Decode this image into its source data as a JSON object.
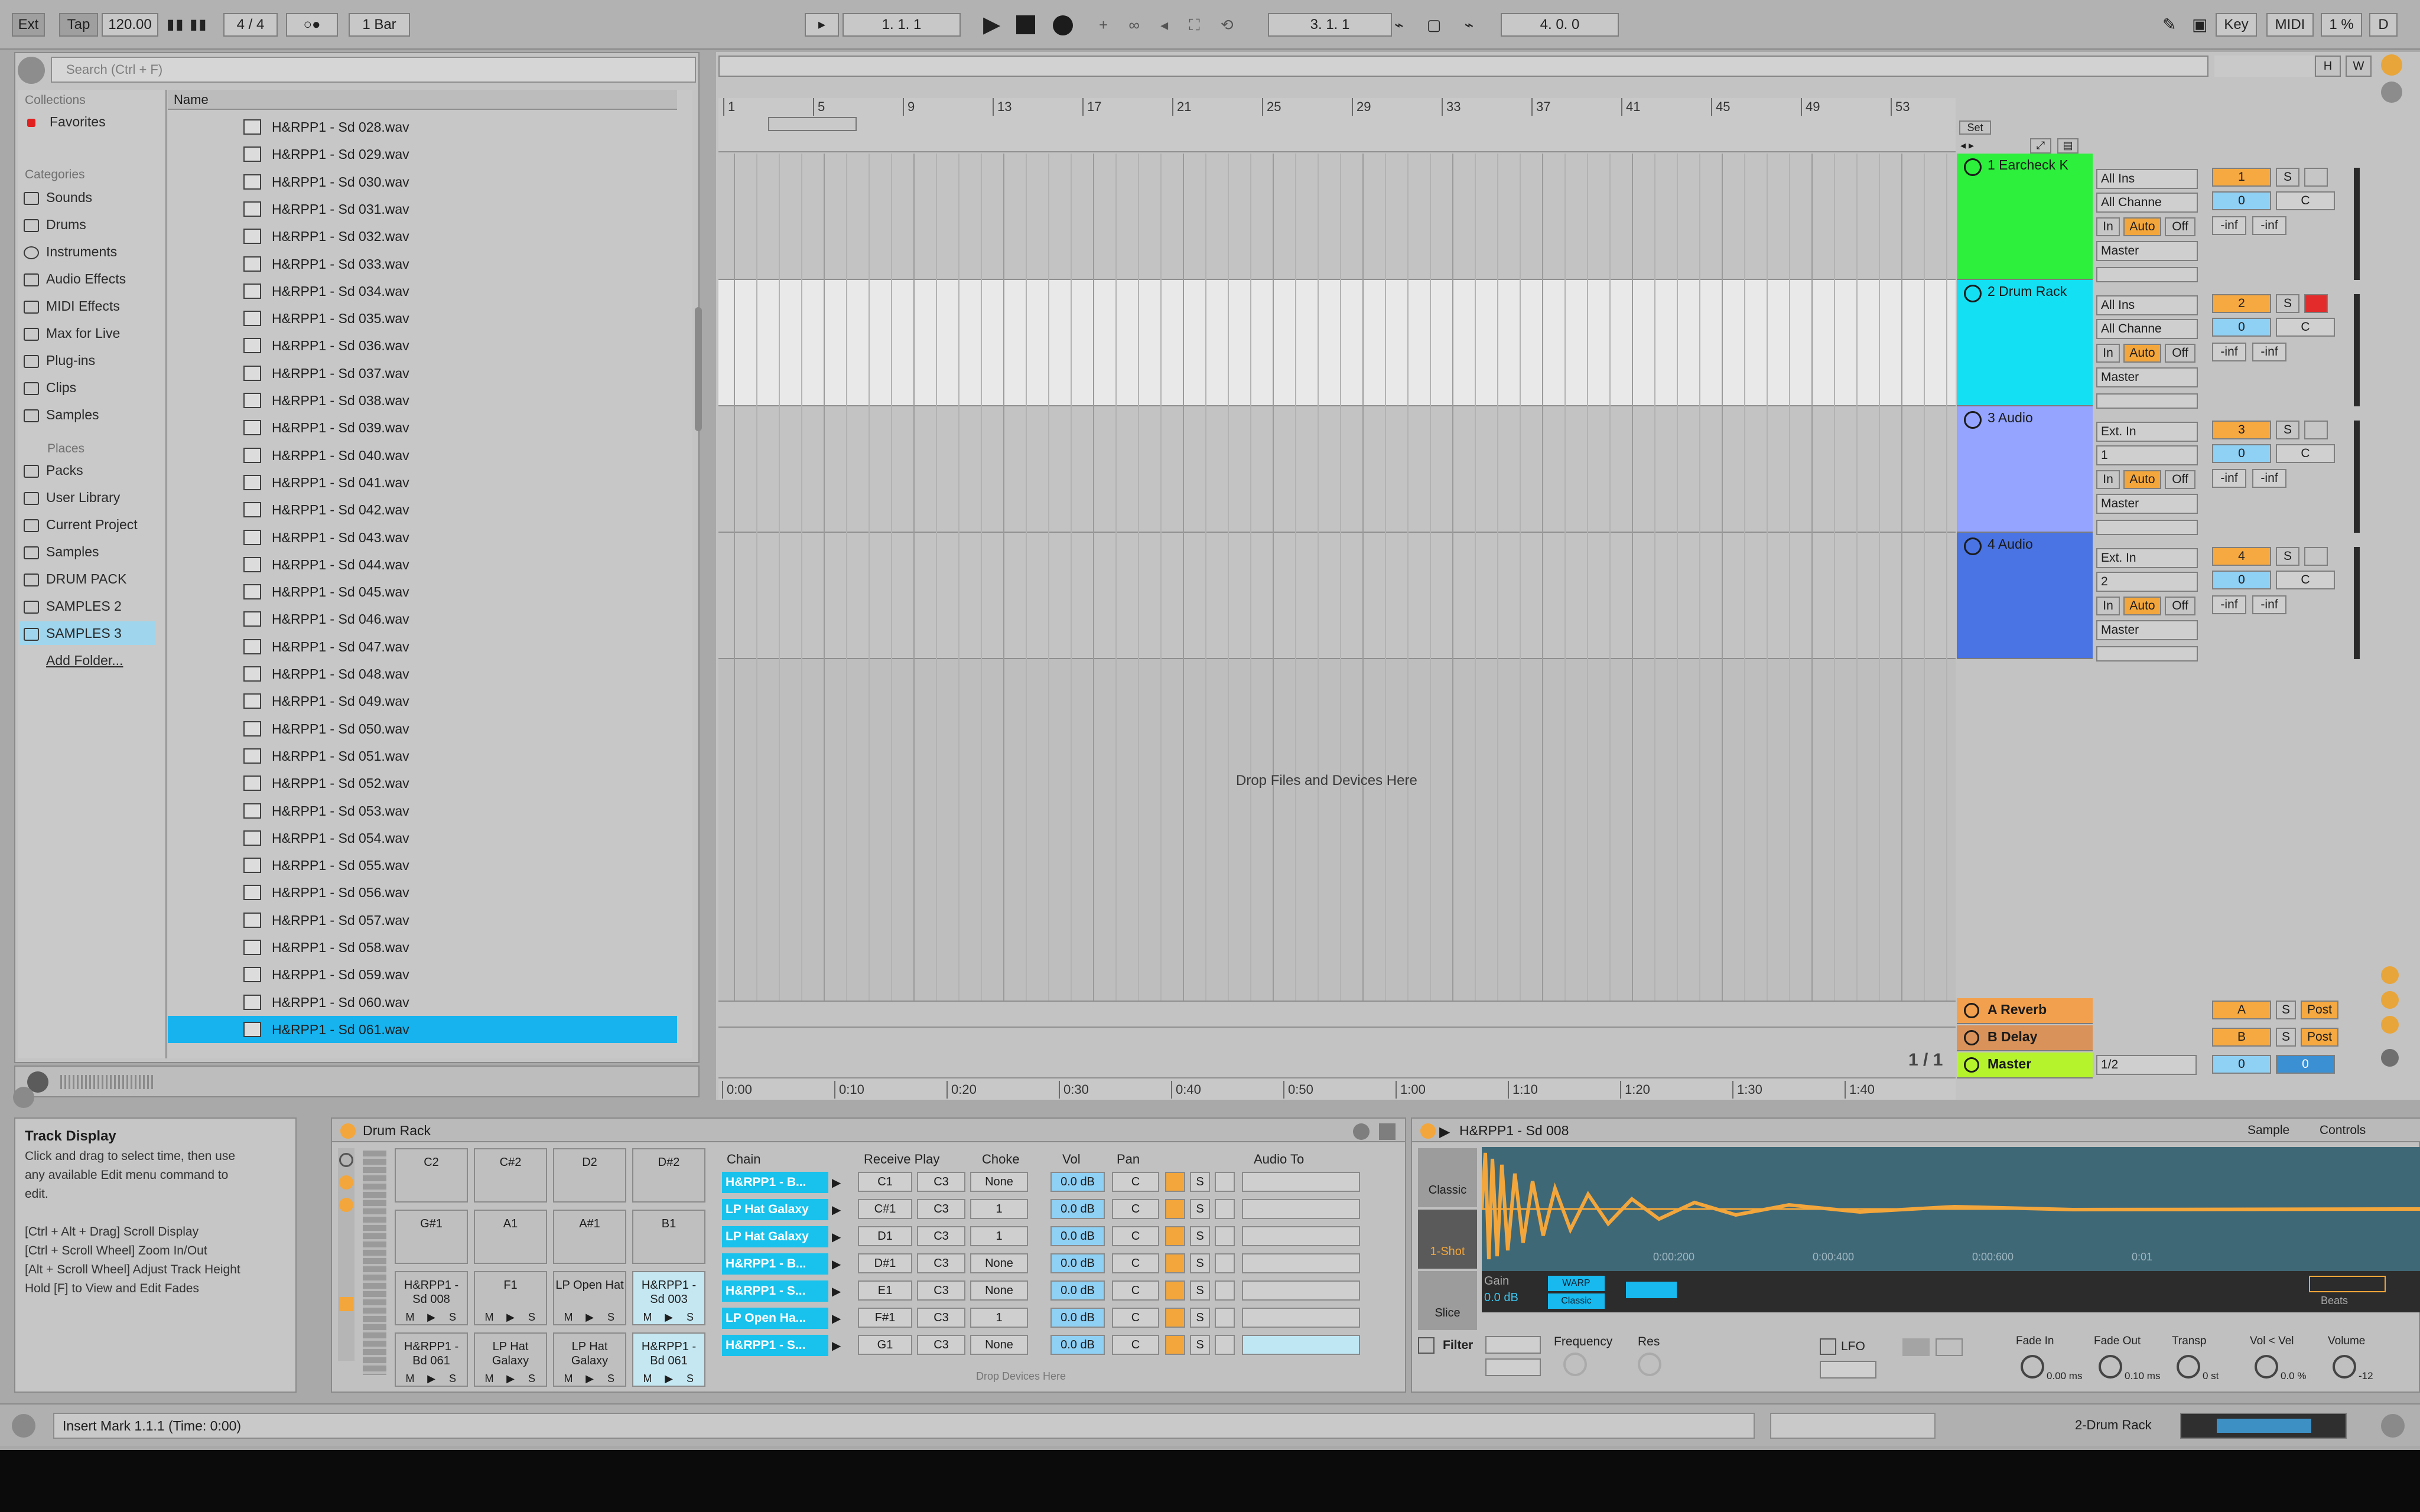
{
  "topbar": {
    "ext": "Ext",
    "tap": "Tap",
    "tempo": "120.00",
    "sig": "4 / 4",
    "metro": "○●",
    "quant": "1 Bar",
    "pos1": "1.  1.  1",
    "pos2": "3.  1.  1",
    "len": "4.  0.  0",
    "key": "Key",
    "midi": "MIDI",
    "cpu": "1 %",
    "d": "D"
  },
  "browser": {
    "search_placeholder": "Search (Ctrl + F)",
    "collections_head": "Collections",
    "favorites": "Favorites",
    "categories_head": "Categories",
    "categories": [
      "Sounds",
      "Drums",
      "Instruments",
      "Audio Effects",
      "MIDI Effects",
      "Max for Live",
      "Plug-ins",
      "Clips",
      "Samples"
    ],
    "places_head": "Places",
    "places": [
      "Packs",
      "User Library",
      "Current Project",
      "Samples",
      "DRUM PACK",
      "SAMPLES 2",
      "SAMPLES 3",
      "Add Folder..."
    ],
    "name_col": "Name",
    "files": [
      "H&RPP1 - Sd 028.wav",
      "H&RPP1 - Sd 029.wav",
      "H&RPP1 - Sd 030.wav",
      "H&RPP1 - Sd 031.wav",
      "H&RPP1 - Sd 032.wav",
      "H&RPP1 - Sd 033.wav",
      "H&RPP1 - Sd 034.wav",
      "H&RPP1 - Sd 035.wav",
      "H&RPP1 - Sd 036.wav",
      "H&RPP1 - Sd 037.wav",
      "H&RPP1 - Sd 038.wav",
      "H&RPP1 - Sd 039.wav",
      "H&RPP1 - Sd 040.wav",
      "H&RPP1 - Sd 041.wav",
      "H&RPP1 - Sd 042.wav",
      "H&RPP1 - Sd 043.wav",
      "H&RPP1 - Sd 044.wav",
      "H&RPP1 - Sd 045.wav",
      "H&RPP1 - Sd 046.wav",
      "H&RPP1 - Sd 047.wav",
      "H&RPP1 - Sd 048.wav",
      "H&RPP1 - Sd 049.wav",
      "H&RPP1 - Sd 050.wav",
      "H&RPP1 - Sd 051.wav",
      "H&RPP1 - Sd 052.wav",
      "H&RPP1 - Sd 053.wav",
      "H&RPP1 - Sd 054.wav",
      "H&RPP1 - Sd 055.wav",
      "H&RPP1 - Sd 056.wav",
      "H&RPP1 - Sd 057.wav",
      "H&RPP1 - Sd 058.wav",
      "H&RPP1 - Sd 059.wav",
      "H&RPP1 - Sd 060.wav",
      "H&RPP1 - Sd 061.wav"
    ],
    "selected_index": 33
  },
  "arrangement": {
    "bars": [
      "1",
      "5",
      "9",
      "13",
      "17",
      "21",
      "25",
      "29",
      "33",
      "37",
      "41",
      "45",
      "49",
      "53"
    ],
    "times": [
      "0:00",
      "0:10",
      "0:20",
      "0:30",
      "0:40",
      "0:50",
      "1:00",
      "1:10",
      "1:20",
      "1:30",
      "1:40"
    ],
    "drop_msg": "Drop Files and Devices Here",
    "page": "1 / 1",
    "set": "Set"
  },
  "tracks": [
    {
      "name": "1 Earcheck K",
      "color": "#2cf03c",
      "input": "All Ins",
      "channel": "All Channe",
      "out": "Master",
      "num": "1",
      "vol": "0",
      "pan": "C",
      "armed": false
    },
    {
      "name": "2 Drum Rack",
      "color": "#14e0f4",
      "input": "All Ins",
      "channel": "All Channe",
      "out": "Master",
      "num": "2",
      "vol": "0",
      "pan": "C",
      "armed": true
    },
    {
      "name": "3 Audio",
      "color": "#94a4ff",
      "input": "Ext. In",
      "channel": "1",
      "out": "Master",
      "num": "3",
      "vol": "0",
      "pan": "C",
      "armed": false
    },
    {
      "name": "4 Audio",
      "color": "#4a74e4",
      "input": "Ext. In",
      "channel": "2",
      "out": "Master",
      "num": "4",
      "vol": "0",
      "pan": "C",
      "armed": false
    }
  ],
  "monitor": {
    "in": "In",
    "auto": "Auto",
    "off": "Off"
  },
  "inf": "-inf",
  "returns": [
    {
      "name": "A Reverb",
      "color": "#f2a04e",
      "num": "A",
      "post": "Post"
    },
    {
      "name": "B Delay",
      "color": "#d9935a",
      "num": "B",
      "post": "Post"
    }
  ],
  "master": {
    "name": "Master",
    "color": "#b5f32d",
    "sel": "1/2",
    "vol": "0",
    "pan": "0"
  },
  "solo": "S",
  "info": {
    "title": "Track Display",
    "lines": [
      "Click and drag to select time, then use",
      "any available Edit menu command to",
      "edit.",
      "",
      "[Ctrl + Alt + Drag] Scroll Display",
      "[Ctrl + Scroll Wheel] Zoom In/Out",
      "[Alt + Scroll Wheel] Adjust Track Height",
      "Hold [F] to View and Edit Fades"
    ]
  },
  "drumrack": {
    "title": "Drum Rack",
    "pads": [
      [
        "C2",
        "C#2",
        "D2",
        "D#2"
      ],
      [
        "G#1",
        "A1",
        "A#1",
        "B1"
      ],
      [
        "H&RPP1 - Sd 008",
        "F1",
        "LP Open Hat",
        "H&RPP1 - Sd 003"
      ],
      [
        "H&RPP1 - Bd 061",
        "LP Hat Galaxy",
        "LP Hat Galaxy",
        "H&RPP1 - Bd 061"
      ]
    ],
    "ms": [
      "M",
      "▶",
      "S"
    ],
    "headers": [
      "Chain",
      "Receive Play",
      "Choke",
      "Vol",
      "Pan",
      "Audio To"
    ],
    "chains": [
      {
        "name": "H&RPP1 - B...",
        "recv": "C1",
        "play": "C3",
        "choke": "None",
        "vol": "0.0 dB",
        "pan": "C"
      },
      {
        "name": "LP Hat Galaxy",
        "recv": "C#1",
        "play": "C3",
        "choke": "1",
        "vol": "0.0 dB",
        "pan": "C"
      },
      {
        "name": "LP Hat Galaxy",
        "recv": "D1",
        "play": "C3",
        "choke": "1",
        "vol": "0.0 dB",
        "pan": "C"
      },
      {
        "name": "H&RPP1 - B...",
        "recv": "D#1",
        "play": "C3",
        "choke": "None",
        "vol": "0.0 dB",
        "pan": "C"
      },
      {
        "name": "H&RPP1 - S...",
        "recv": "E1",
        "play": "C3",
        "choke": "None",
        "vol": "0.0 dB",
        "pan": "C"
      },
      {
        "name": "LP Open Ha...",
        "recv": "F#1",
        "play": "C3",
        "choke": "1",
        "vol": "0.0 dB",
        "pan": "C"
      },
      {
        "name": "H&RPP1 - S...",
        "recv": "G1",
        "play": "C3",
        "choke": "None",
        "vol": "0.0 dB",
        "pan": "C"
      }
    ],
    "drop": "Drop Devices Here"
  },
  "sampler": {
    "title": "H&RPP1 - Sd 008",
    "tabs": [
      "Sample",
      "Controls"
    ],
    "side": [
      "Classic",
      "1-Shot",
      "Slice"
    ],
    "gain_label": "Gain",
    "gain": "0.0 dB",
    "mode": "Classic",
    "warp": "WARP",
    "beats": "Beats",
    "timeline": [
      "0:00:200",
      "0:00:400",
      "0:00:600",
      "0:01"
    ],
    "filter": "Filter",
    "frequency": "Frequency",
    "res": "Res",
    "lfo": "LFO",
    "knobs": [
      {
        "label": "Fade In",
        "value": "0.00 ms"
      },
      {
        "label": "Fade Out",
        "value": "0.10 ms"
      },
      {
        "label": "Transp",
        "value": "0 st"
      },
      {
        "label": "Vol < Vel",
        "value": "0.0 %"
      },
      {
        "label": "Volume",
        "value": "-12"
      }
    ]
  },
  "status": {
    "message": "Insert Mark 1.1.1 (Time: 0:00)",
    "track": "2-Drum Rack"
  }
}
